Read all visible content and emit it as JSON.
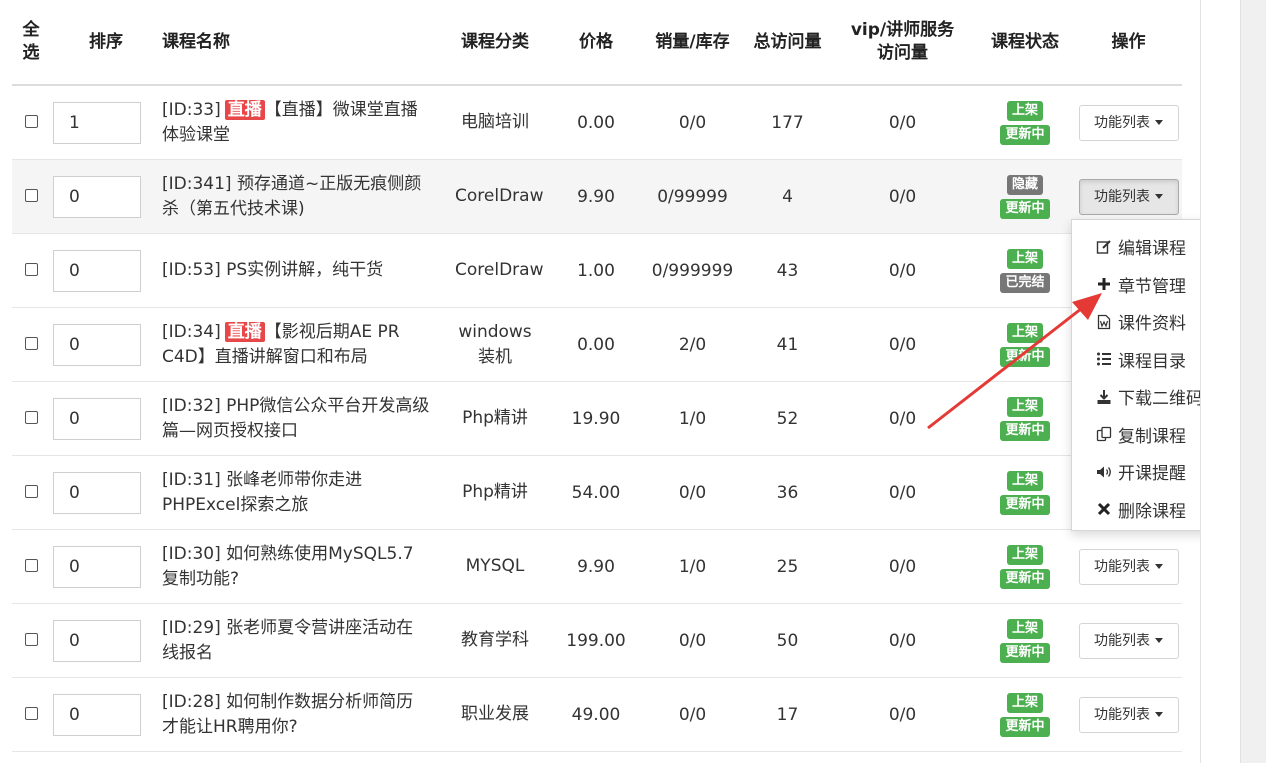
{
  "headers": {
    "select_all": "全选",
    "sort": "排序",
    "name": "课程名称",
    "category": "课程分类",
    "price": "价格",
    "sales_stock": "销量/库存",
    "visits": "总访问量",
    "vip_visits": "vip/讲师服务访问量",
    "status": "课程状态",
    "actions": "操作"
  },
  "action_label": "功能列表",
  "rows": [
    {
      "sort": "1",
      "id": "[ID:33]",
      "live": "直播",
      "title": "【直播】微课堂直播体验课堂",
      "category": "电脑培训",
      "price": "0.00",
      "sales": "0/0",
      "visits": "177",
      "vip": "0/0",
      "status1": "上架",
      "status2": "更新中"
    },
    {
      "sort": "0",
      "id": "[ID:341]",
      "live": "",
      "title": " 预存通道~正版无痕侧颜杀（第五代技术课)",
      "category": "CorelDraw",
      "price": "9.90",
      "sales": "0/99999",
      "visits": "4",
      "vip": "0/0",
      "status1": "隐藏",
      "status2": "更新中"
    },
    {
      "sort": "0",
      "id": "[ID:53]",
      "live": "",
      "title": " PS实例讲解，纯干货",
      "category": "CorelDraw",
      "price": "1.00",
      "sales": "0/999999",
      "visits": "43",
      "vip": "0/0",
      "status1": "上架",
      "status2": "已完结"
    },
    {
      "sort": "0",
      "id": "[ID:34]",
      "live": "直播",
      "title": "【影视后期AE PR C4D】直播讲解窗口和布局",
      "category": "windows装机",
      "price": "0.00",
      "sales": "2/0",
      "visits": "41",
      "vip": "0/0",
      "status1": "上架",
      "status2": "更新中"
    },
    {
      "sort": "0",
      "id": "[ID:32]",
      "live": "",
      "title": " PHP微信公众平台开发高级篇—网页授权接口",
      "category": "Php精讲",
      "price": "19.90",
      "sales": "1/0",
      "visits": "52",
      "vip": "0/0",
      "status1": "上架",
      "status2": "更新中"
    },
    {
      "sort": "0",
      "id": "[ID:31]",
      "live": "",
      "title": " 张峰老师带你走进PHPExcel探索之旅",
      "category": "Php精讲",
      "price": "54.00",
      "sales": "0/0",
      "visits": "36",
      "vip": "0/0",
      "status1": "上架",
      "status2": "更新中"
    },
    {
      "sort": "0",
      "id": "[ID:30]",
      "live": "",
      "title": " 如何熟练使用MySQL5.7复制功能?",
      "category": "MYSQL",
      "price": "9.90",
      "sales": "1/0",
      "visits": "25",
      "vip": "0/0",
      "status1": "上架",
      "status2": "更新中"
    },
    {
      "sort": "0",
      "id": "[ID:29]",
      "live": "",
      "title": " 张老师夏令营讲座活动在线报名",
      "category": "教育学科",
      "price": "199.00",
      "sales": "0/0",
      "visits": "50",
      "vip": "0/0",
      "status1": "上架",
      "status2": "更新中"
    },
    {
      "sort": "0",
      "id": "[ID:28]",
      "live": "",
      "title": " 如何制作数据分析师简历才能让HR聘用你?",
      "category": "职业发展",
      "price": "49.00",
      "sales": "0/0",
      "visits": "17",
      "vip": "0/0",
      "status1": "上架",
      "status2": "更新中"
    }
  ],
  "dropdown": [
    {
      "icon": "edit-icon",
      "label": "编辑课程"
    },
    {
      "icon": "plus-icon",
      "label": "章节管理"
    },
    {
      "icon": "word-file-icon",
      "label": "课件资料"
    },
    {
      "icon": "list-icon",
      "label": "课程目录"
    },
    {
      "icon": "download-icon",
      "label": "下载二维码"
    },
    {
      "icon": "copy-icon",
      "label": "复制课程"
    },
    {
      "icon": "volume-icon",
      "label": "开课提醒"
    },
    {
      "icon": "close-icon",
      "label": "删除课程"
    }
  ],
  "colors": {
    "live": "#e8474a",
    "green": "#4caf50",
    "gray": "#777777",
    "arrow": "#e53935"
  }
}
